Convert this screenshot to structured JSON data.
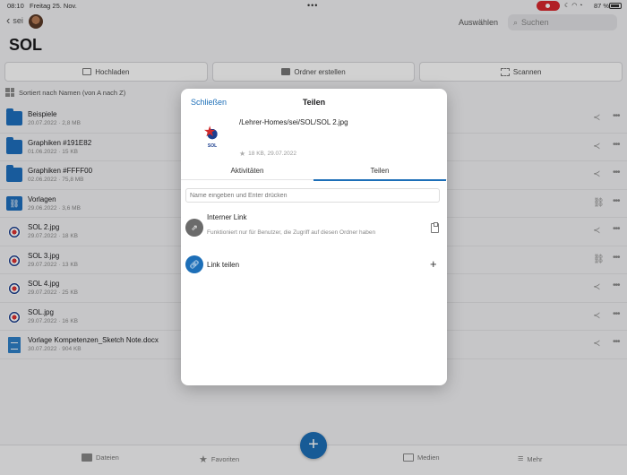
{
  "status": {
    "time": "08:10",
    "date": "Freitag 25. Nov.",
    "battery": "87 %"
  },
  "topbar": {
    "back_label": "sei",
    "select_label": "Auswählen",
    "search_placeholder": "Suchen"
  },
  "page": {
    "title": "SOL"
  },
  "actions": {
    "upload": "Hochladen",
    "create_folder": "Ordner erstellen",
    "scan": "Scannen"
  },
  "sort": {
    "label": "Sortiert nach Namen (von A nach Z)"
  },
  "files": [
    {
      "name": "Beispiele",
      "meta": "20.07.2022 · 2,8 MB",
      "kind": "folder",
      "shared": false
    },
    {
      "name": "Graphiken #191E82",
      "meta": "01.06.2022 · 15 KB",
      "kind": "folder",
      "shared": false
    },
    {
      "name": "Graphiken #FFFF00",
      "meta": "02.06.2022 · 75,8 MB",
      "kind": "folder",
      "shared": false
    },
    {
      "name": "Vorlagen",
      "meta": "29.06.2022 · 3,6 MB",
      "kind": "folder-link",
      "shared": true
    },
    {
      "name": "SOL 2.jpg",
      "meta": "29.07.2022 · 18 KB",
      "kind": "image",
      "shared": false
    },
    {
      "name": "SOL 3.jpg",
      "meta": "29.07.2022 · 13 KB",
      "kind": "image",
      "shared": true
    },
    {
      "name": "SOL 4.jpg",
      "meta": "29.07.2022 · 25 KB",
      "kind": "image",
      "shared": false
    },
    {
      "name": "SOL.jpg",
      "meta": "29.07.2022 · 16 KB",
      "kind": "image",
      "shared": false
    },
    {
      "name": "Vorlage Kompetenzen_Sketch Note.docx",
      "meta": "30.07.2022 · 904 KB",
      "kind": "doc",
      "shared": false
    }
  ],
  "tabbar": {
    "files": "Dateien",
    "favorites": "Favoriten",
    "media": "Medien",
    "more": "Mehr"
  },
  "modal": {
    "close_label": "Schließen",
    "title": "Teilen",
    "logo_text": "SOL",
    "file_path": "/Lehrer-Homes/sei/SOL/SOL 2.jpg",
    "file_info": "18 KB, 29.07.2022",
    "tabs": {
      "activities": "Aktivitäten",
      "share": "Teilen"
    },
    "name_placeholder": "Name eingeben und Enter drücken",
    "internal_link": {
      "title": "Interner Link",
      "description": "Funktioniert nur für Benutzer, die Zugriff auf diesen Ordner haben"
    },
    "share_link_label": "Link teilen"
  },
  "colors": {
    "accent": "#1d6fb8",
    "folder": "#1e6fbf",
    "record": "#d8282e"
  }
}
